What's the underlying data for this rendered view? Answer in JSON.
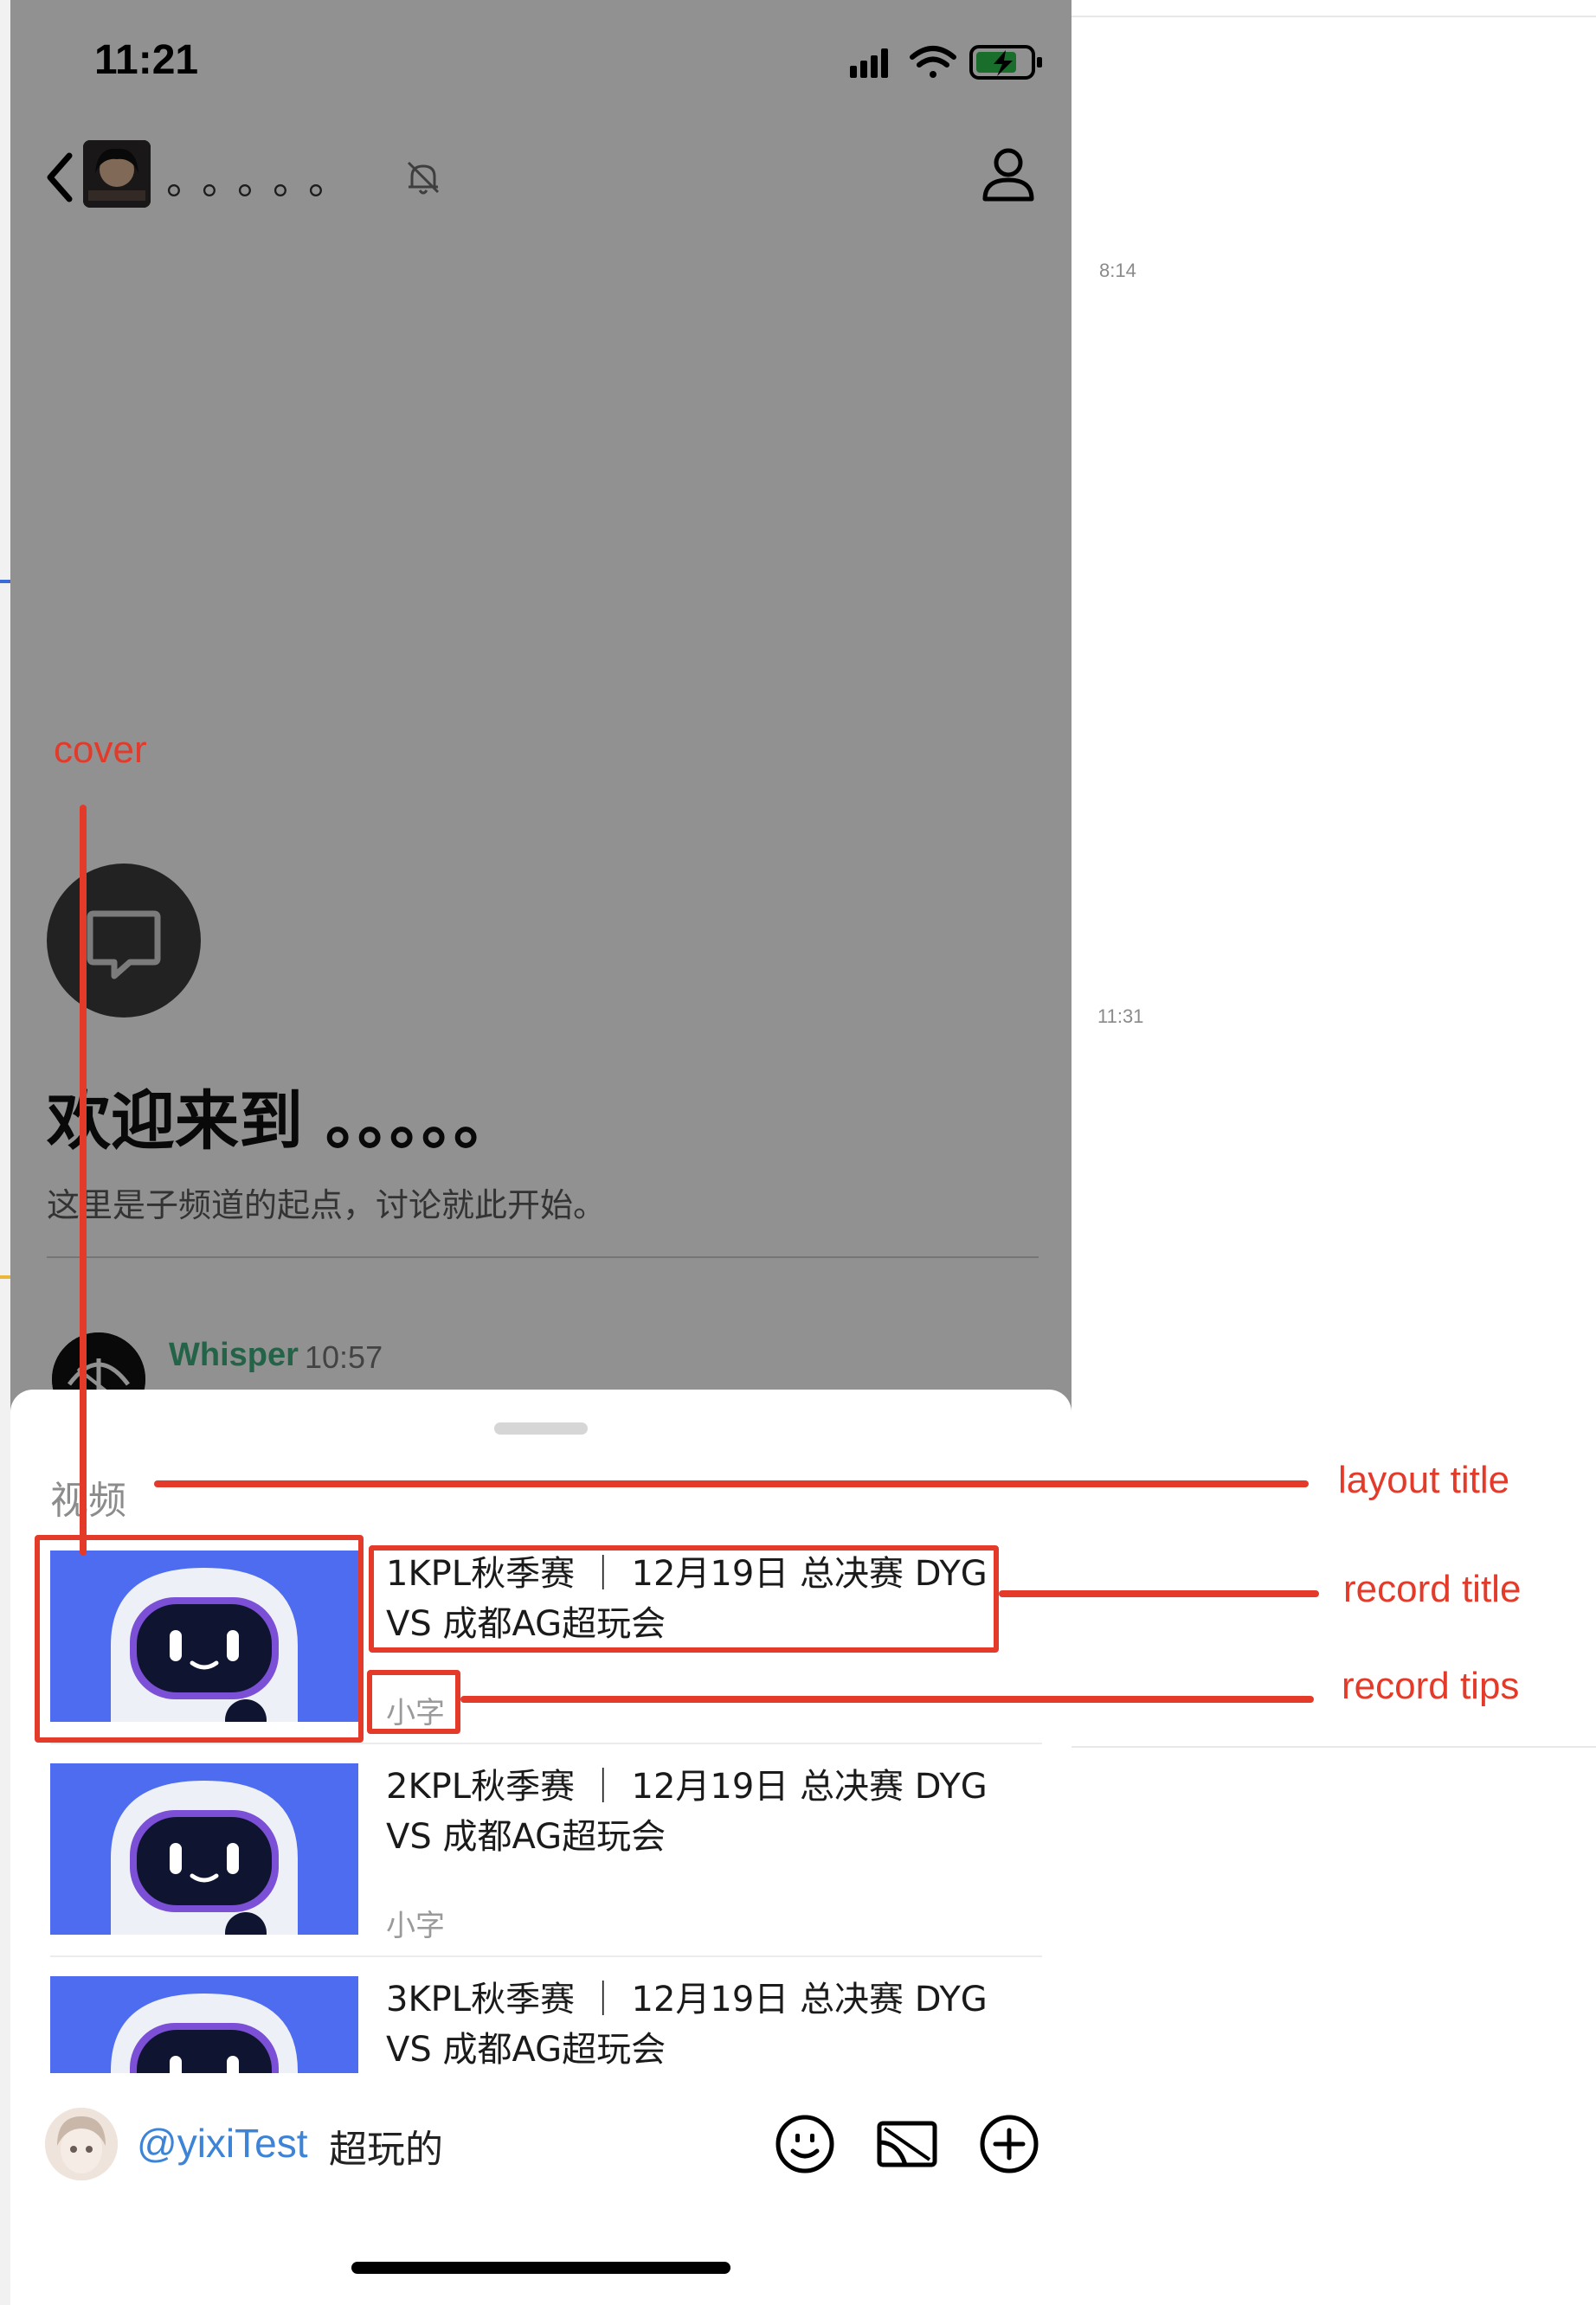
{
  "status_bar": {
    "time": "11:21"
  },
  "header": {
    "channel_name": "。。。。。",
    "back_icon": "chevron-left-icon",
    "mute_icon": "bell-slash-icon",
    "profile_icon": "person-icon"
  },
  "background_app": {
    "timestamps": [
      "8:14",
      "11:31"
    ]
  },
  "welcome": {
    "title": "欢迎来到 。。。。。",
    "subtitle": "这里是子频道的起点，讨论就此开始。",
    "icon": "chat-bubble-icon"
  },
  "message": {
    "author": "Whisper",
    "time": "10:57"
  },
  "sheet": {
    "layout_title": "视频",
    "records": [
      {
        "title": "1KPL秋季赛 ｜ 12月19日 总决赛 DYG VS 成都AG超玩会",
        "tips": "小字"
      },
      {
        "title": "2KPL秋季赛 ｜ 12月19日 总决赛 DYG VS 成都AG超玩会",
        "tips": "小字"
      },
      {
        "title": "3KPL秋季赛 ｜ 12月19日 总决赛 DYG VS 成都AG超玩会",
        "tips": ""
      }
    ]
  },
  "input_bar": {
    "mention": "@yixiTest",
    "text": "超玩的",
    "icons": [
      "emoji-icon",
      "cast-screen-icon",
      "plus-circle-icon"
    ]
  },
  "annotations": {
    "cover": "cover",
    "layout_title": "layout title",
    "record_title": "record title",
    "record_tips": "record tips"
  },
  "colors": {
    "annotation": "#e33a2a",
    "mention": "#3d84d6",
    "author": "#3fae7e",
    "cover_bg": "#4e6cf0"
  }
}
